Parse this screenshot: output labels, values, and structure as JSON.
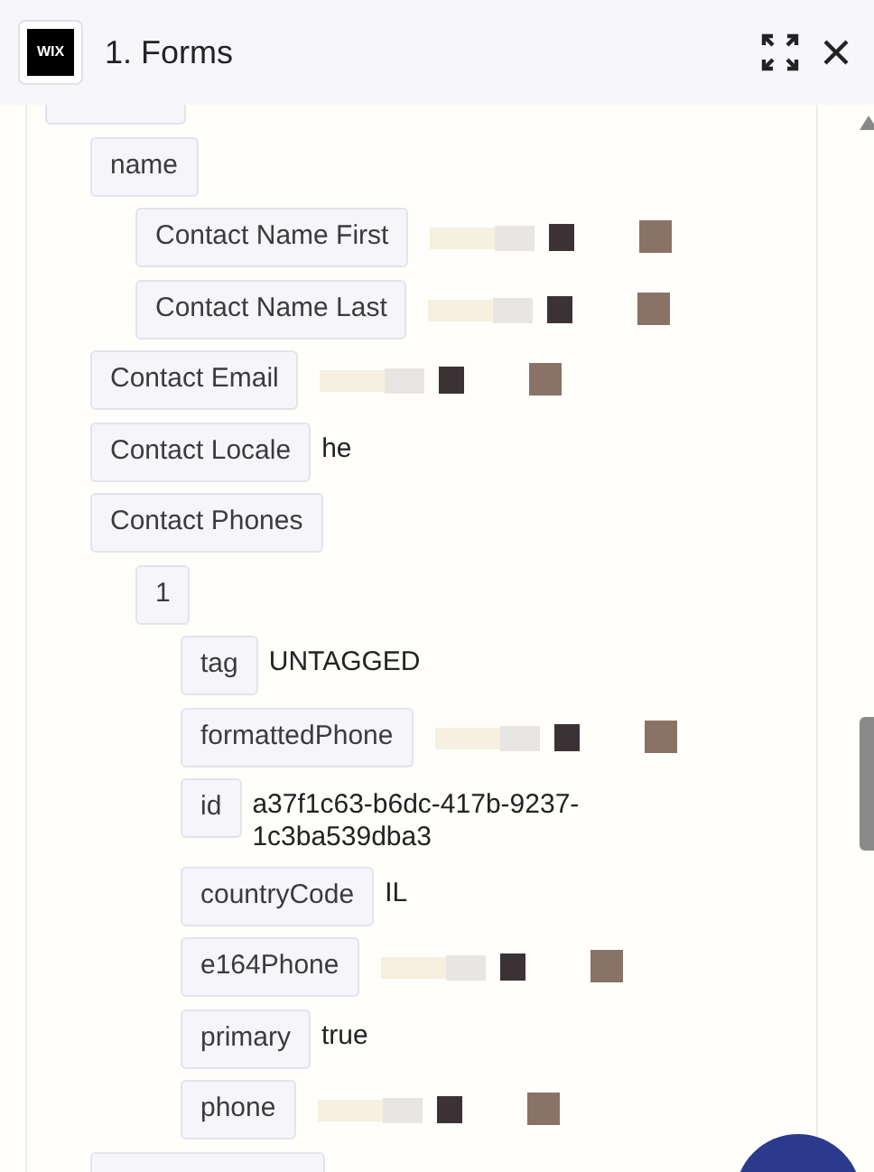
{
  "header": {
    "logo": "WIX",
    "title": "1. Forms"
  },
  "tree": [
    {
      "key": "name",
      "children": [
        {
          "key": "Contact Name First",
          "redacted": true
        },
        {
          "key": "Contact Name Last",
          "redacted": true
        }
      ]
    },
    {
      "key": "Contact Email",
      "redacted": true
    },
    {
      "key": "Contact Locale",
      "value": "he"
    },
    {
      "key": "Contact Phones",
      "children": [
        {
          "key": "1",
          "children": [
            {
              "key": "tag",
              "value": "UNTAGGED"
            },
            {
              "key": "formattedPhone",
              "redacted": true
            },
            {
              "key": "id",
              "value": "a37f1c63-b6dc-417b-9237-1c3ba539dba3"
            },
            {
              "key": "countryCode",
              "value": "IL"
            },
            {
              "key": "e164Phone",
              "redacted": true
            },
            {
              "key": "primary",
              "value": "true"
            },
            {
              "key": "phone",
              "redacted": true
            }
          ]
        }
      ]
    }
  ]
}
